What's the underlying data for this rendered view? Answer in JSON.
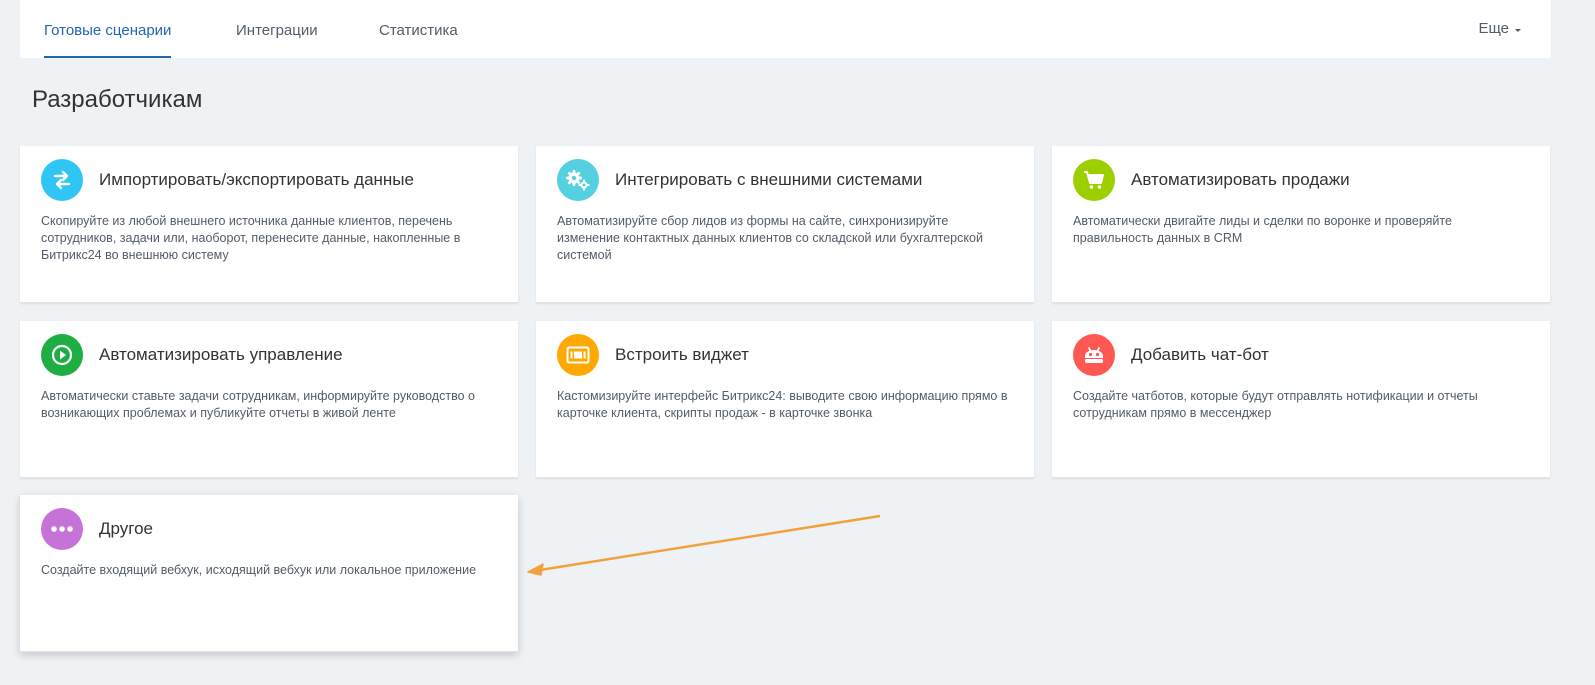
{
  "tabs": [
    {
      "label": "Готовые сценарии",
      "active": true
    },
    {
      "label": "Интеграции",
      "active": false
    },
    {
      "label": "Статистика",
      "active": false
    }
  ],
  "more_label": "Еще",
  "section_title": "Разработчикам",
  "cards": [
    {
      "title": "Импортировать/экспортировать данные",
      "description": "Скопируйте из любой внешнего источника данные клиентов, перечень сотрудников, задачи или, наоборот, перенесите данные, накопленные в Битрикс24 во внешнюю систему",
      "icon": "exchange-arrows-icon",
      "color": "#2fc6f6"
    },
    {
      "title": "Интегрировать с внешними системами",
      "description": "Автоматизируйте сбор лидов из формы на сайте, синхронизируйте изменение контактных данных клиентов со складской или бухгалтерской системой",
      "icon": "gears-icon",
      "color": "#55d0e0"
    },
    {
      "title": "Автоматизировать продажи",
      "description": "Автоматически двигайте лиды и сделки по воронке и проверяйте правильность данных в CRM",
      "icon": "shopping-cart-icon",
      "color": "#9dcf00"
    },
    {
      "title": "Автоматизировать управление",
      "description": "Автоматически ставьте задачи сотрудникам, информируйте руководство о возникающих проблемах и публикуйте отчеты в живой ленте",
      "icon": "play-icon",
      "color": "#1eae43"
    },
    {
      "title": "Встроить виджет",
      "description": "Кастомизируйте интерфейс Битрикс24: выводите свою информацию прямо в карточке клиента, скрипты продаж - в карточке звонка",
      "icon": "widget-icon",
      "color": "#ffa900"
    },
    {
      "title": "Добавить чат-бот",
      "description": "Создайте чатботов, которые будут отправлять нотификации и отчеты сотрудникам прямо в мессенджер",
      "icon": "robot-icon",
      "color": "#ff5752"
    },
    {
      "title": "Другое",
      "description": "Создайте входящий вебхук, исходящий вебхук или локальное приложение",
      "icon": "more-dots-icon",
      "color": "#c573d6"
    }
  ],
  "annotation": {
    "icon": "arrow-annotation-icon",
    "color": "#f2a03d"
  }
}
